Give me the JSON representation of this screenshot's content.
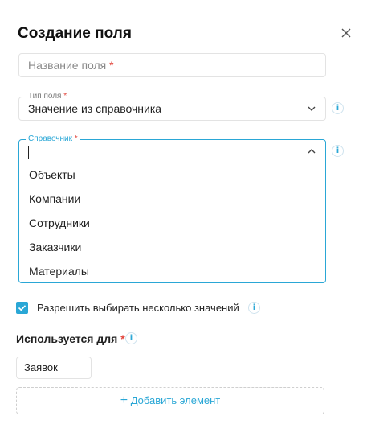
{
  "dialog": {
    "title": "Создание поля"
  },
  "field_name": {
    "placeholder": "Название поля",
    "required_mark": "*",
    "value": ""
  },
  "field_type": {
    "label": "Тип поля",
    "required_mark": "*",
    "value": "Значение из справочника"
  },
  "reference": {
    "label": "Справочник",
    "required_mark": "*",
    "value": "",
    "options": [
      "Объекты",
      "Компании",
      "Сотрудники",
      "Заказчики",
      "Материалы"
    ]
  },
  "multi_select": {
    "checked": true,
    "label": "Разрешить выбирать несколько значений"
  },
  "used_for": {
    "label": "Используется для",
    "required_mark": "*",
    "items": [
      "Заявок"
    ],
    "add_label": "Добавить элемент",
    "add_icon": "+"
  },
  "info_icon": "i",
  "colors": {
    "accent": "#2aa7d6",
    "required": "#e2453c",
    "border": "#e3e3e3"
  }
}
